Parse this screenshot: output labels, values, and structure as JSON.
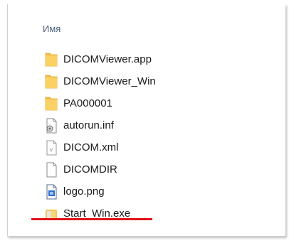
{
  "explorer": {
    "column_header": "Имя",
    "files": [
      {
        "name": "DICOMViewer.app",
        "icon": "folder-icon"
      },
      {
        "name": "DICOMViewer_Win",
        "icon": "folder-icon"
      },
      {
        "name": "PA000001",
        "icon": "folder-icon"
      },
      {
        "name": "autorun.inf",
        "icon": "settings-file-icon"
      },
      {
        "name": "DICOM.xml",
        "icon": "xml-file-icon"
      },
      {
        "name": "DICOMDIR",
        "icon": "blank-file-icon"
      },
      {
        "name": "logo.png",
        "icon": "image-file-icon"
      },
      {
        "name": "Start_Win.exe",
        "icon": "executable-icon"
      }
    ]
  },
  "annotation": {
    "underline_color": "#e0141b"
  }
}
